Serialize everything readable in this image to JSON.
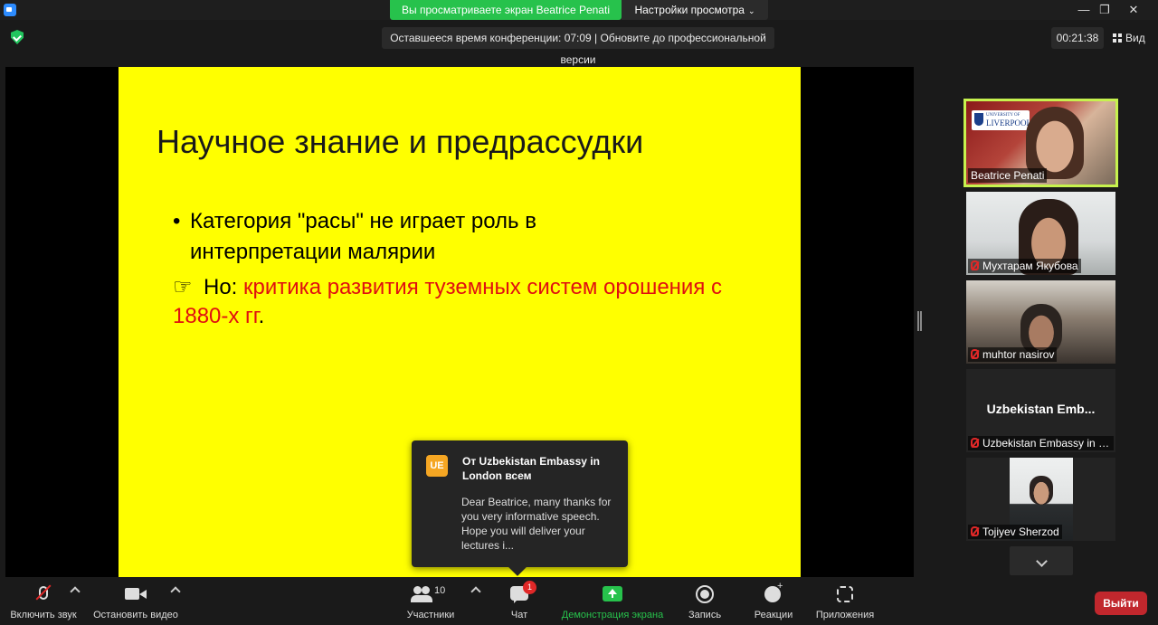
{
  "titlebar": {
    "share_banner": "Вы просматриваете экран Beatrice Penati",
    "view_settings": "Настройки просмотра",
    "minimize": "—",
    "restore": "❐",
    "close": "✕"
  },
  "topbar": {
    "remaining_time": "Оставшееся время конференции: 07:09 | Обновите до профессиональной версии",
    "elapsed": "00:21:38",
    "view_label": "Вид"
  },
  "slide": {
    "title": "Научное знание и предрассудки",
    "bullet1": "Категория \"расы\" не играет роль в интерпретации малярии",
    "bullet_dot": "•",
    "bullet2_hand": "☞",
    "bullet2_prefix": "Но: ",
    "bullet2_red": "критика развития туземных систем орошения с 1880-х гг",
    "bullet2_end": "."
  },
  "participants": [
    {
      "name": "Beatrice Penati",
      "logo_small": "UNIVERSITY OF",
      "logo_big": "LIVERPOOL",
      "muted": false,
      "active": true
    },
    {
      "name": "Мухтарам Якубова",
      "muted": true
    },
    {
      "name": "muhtor nasirov",
      "muted": true
    },
    {
      "name": "Uzbekistan Embassy in L...",
      "display_label": "Uzbekistan  Emb...",
      "muted": true
    },
    {
      "name": "Tojiyev Sherzod",
      "muted": true
    }
  ],
  "chat_popup": {
    "avatar": "UE",
    "from": "От Uzbekistan Embassy in London всем",
    "message": "Dear Beatrice, many thanks for you very informative speech. Hope you will deliver your lectures i..."
  },
  "toolbar": {
    "unmute": "Включить звук",
    "start_video": "Остановить видео",
    "participants": "Участники",
    "participants_count": "10",
    "chat": "Чат",
    "chat_badge": "1",
    "share_screen": "Демонстрация экрана",
    "record": "Запись",
    "reactions": "Реакции",
    "apps": "Приложения",
    "leave": "Выйти"
  },
  "colors": {
    "slide_bg": "#ffff00",
    "slide_red": "#e01010",
    "share_banner": "#27c24c",
    "active_speaker": "#c6f24e",
    "leave": "#c1272d",
    "avatar": "#f5a623"
  }
}
